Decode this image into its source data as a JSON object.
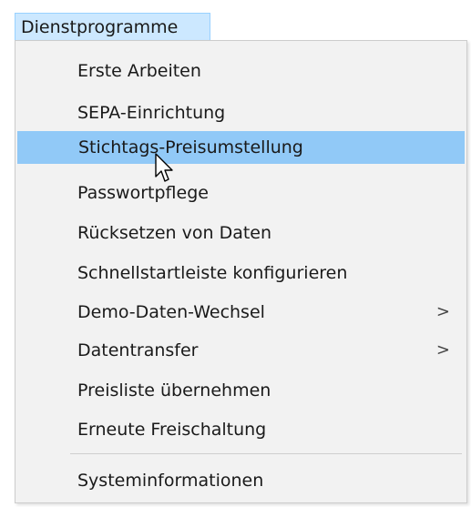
{
  "menubar": {
    "title": "Dienstprogramme"
  },
  "menu": {
    "items": [
      {
        "label": "Erste Arbeiten"
      },
      {
        "label": "SEPA-Einrichtung"
      },
      {
        "label": "Stichtags-Preisumstellung"
      },
      {
        "label": "Passwortpflege"
      },
      {
        "label": "Rücksetzen von Daten"
      },
      {
        "label": "Schnellstartleiste konfigurieren"
      },
      {
        "label": "Demo-Daten-Wechsel",
        "submenu": ">"
      },
      {
        "label": "Datentransfer",
        "submenu": ">"
      },
      {
        "label": "Preisliste übernehmen"
      },
      {
        "label": "Erneute Freischaltung"
      },
      {
        "label": "Systeminformationen"
      }
    ],
    "highlighted_item": "Stichtags-Preisumstellung"
  },
  "colors": {
    "menubar_active_bg": "#cce8ff",
    "menu_bg": "#f2f2f2",
    "highlight_bg": "#91c9f7"
  },
  "icons": {
    "cursor": "mouse-pointer-icon",
    "submenu": "chevron-right-icon"
  }
}
